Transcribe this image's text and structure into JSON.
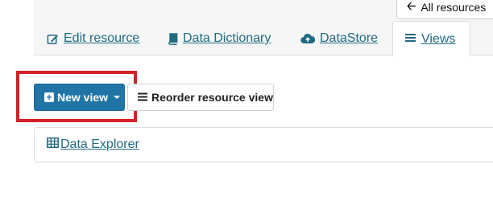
{
  "header": {
    "all_resources_label": "All resources",
    "tabs": [
      {
        "label": "Edit resource",
        "icon": "edit-icon"
      },
      {
        "label": "Data Dictionary",
        "icon": "book-icon"
      },
      {
        "label": "DataStore",
        "icon": "cloud-upload-icon"
      },
      {
        "label": "Views",
        "icon": "list-icon",
        "active": true
      }
    ]
  },
  "toolbar": {
    "new_view_label": "New view",
    "reorder_label": "Reorder resource view"
  },
  "views": [
    {
      "label": "Data Explorer",
      "icon": "table-icon"
    }
  ],
  "colors": {
    "link": "#206b82",
    "primary": "#2175a6",
    "highlight": "#d42127"
  }
}
